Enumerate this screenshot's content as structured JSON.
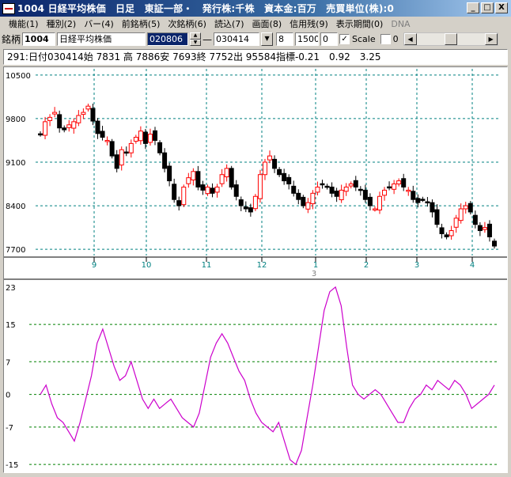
{
  "window": {
    "title": "1004 日経平均株価　日足　東証一部・　発行株:千株　資本金:百万　売買単位(株):0",
    "min_label": "_",
    "max_label": "□",
    "close_label": "X"
  },
  "menu": [
    {
      "label": "機能(1)",
      "enabled": true
    },
    {
      "label": "種別(2)",
      "enabled": true
    },
    {
      "label": "バー(4)",
      "enabled": true
    },
    {
      "label": "前銘柄(5)",
      "enabled": true
    },
    {
      "label": "次銘柄(6)",
      "enabled": true
    },
    {
      "label": "読込(7)",
      "enabled": true
    },
    {
      "label": "画面(8)",
      "enabled": true
    },
    {
      "label": "信用残(9)",
      "enabled": true
    },
    {
      "label": "表示期間(0)",
      "enabled": true
    },
    {
      "label": "DNA",
      "enabled": false
    }
  ],
  "toolbar": {
    "code_label": "銘柄",
    "code_value": "1004",
    "name_value": "日経平均株価",
    "start_date": "020806",
    "dash": "—",
    "end_date": "030414",
    "bar_width": "8",
    "bar_count": "1500",
    "offset": "0",
    "scale_checked": "✓",
    "scale_label": "Scale",
    "scale_value_checked": "",
    "scale_value": "0"
  },
  "info": {
    "text": "291:日付030414始 7831 高 7886安 7693終 7752出 95584指標-0.21　0.92　3.25"
  },
  "colors": {
    "up_candle": "#ff0000",
    "down_candle": "#000000",
    "grid": "#008080",
    "axis_text": "#008080",
    "oscillator": "#cc00cc",
    "osc_grid": "#008000"
  },
  "chart_data": [
    {
      "type": "candlestick",
      "title": "",
      "y_ticks": [
        10500,
        9800,
        9100,
        8400,
        7700
      ],
      "ylim": [
        7600,
        10600
      ],
      "x_ticks": [
        "9",
        "10",
        "11",
        "12",
        "1",
        "2",
        "3",
        "4"
      ],
      "year_label": "3",
      "close_approx": [
        9550,
        9750,
        9820,
        9900,
        9650,
        9620,
        9700,
        9750,
        9850,
        9900,
        10000,
        9760,
        9560,
        9500,
        9450,
        9200,
        9000,
        9300,
        9250,
        9400,
        9500,
        9600,
        9400,
        9550,
        9450,
        9250,
        9000,
        8800,
        8500,
        8400,
        8700,
        8850,
        8950,
        8700,
        8650,
        8700,
        8600,
        8700,
        8900,
        9000,
        8700,
        8550,
        8400,
        8350,
        8300,
        8550,
        8900,
        9100,
        9200,
        9000,
        8900,
        8800,
        8750,
        8600,
        8500,
        8400,
        8450,
        8600,
        8700,
        8750,
        8700,
        8600,
        8550,
        8650,
        8700,
        8750,
        8700,
        8650,
        8500,
        8400,
        8350,
        8550,
        8650,
        8700,
        8750,
        8800,
        8700,
        8650,
        8500,
        8450,
        8500,
        8450,
        8300,
        8100,
        7950,
        7900,
        8000,
        8200,
        8350,
        8400,
        8300,
        8100,
        8000,
        8050,
        7900,
        7752
      ],
      "last": {
        "open": 7831,
        "high": 7886,
        "low": 7693,
        "close": 7752
      }
    },
    {
      "type": "line",
      "title": "",
      "y_ticks": [
        23,
        15,
        7,
        0,
        -7,
        -15
      ],
      "ylim": [
        -16,
        24
      ],
      "series": [
        {
          "values": [
            0,
            2,
            -2,
            -5,
            -6,
            -8,
            -10,
            -6,
            -1,
            4,
            11,
            14,
            10,
            6,
            3,
            4,
            7,
            3,
            -1,
            -3,
            -1,
            -3,
            -2,
            -1,
            -3,
            -5,
            -6,
            -7,
            -4,
            2,
            8,
            11,
            13,
            11,
            8,
            5,
            3,
            -1,
            -4,
            -6,
            -7,
            -8,
            -6,
            -10,
            -14,
            -15,
            -12,
            -5,
            2,
            10,
            18,
            22,
            23,
            19,
            10,
            2,
            0,
            -1,
            0,
            1,
            0,
            -2,
            -4,
            -6,
            -6,
            -3,
            -1,
            0,
            2,
            1,
            3,
            2,
            1,
            3,
            2,
            0,
            -3,
            -2,
            -1,
            0,
            2
          ]
        }
      ]
    }
  ]
}
